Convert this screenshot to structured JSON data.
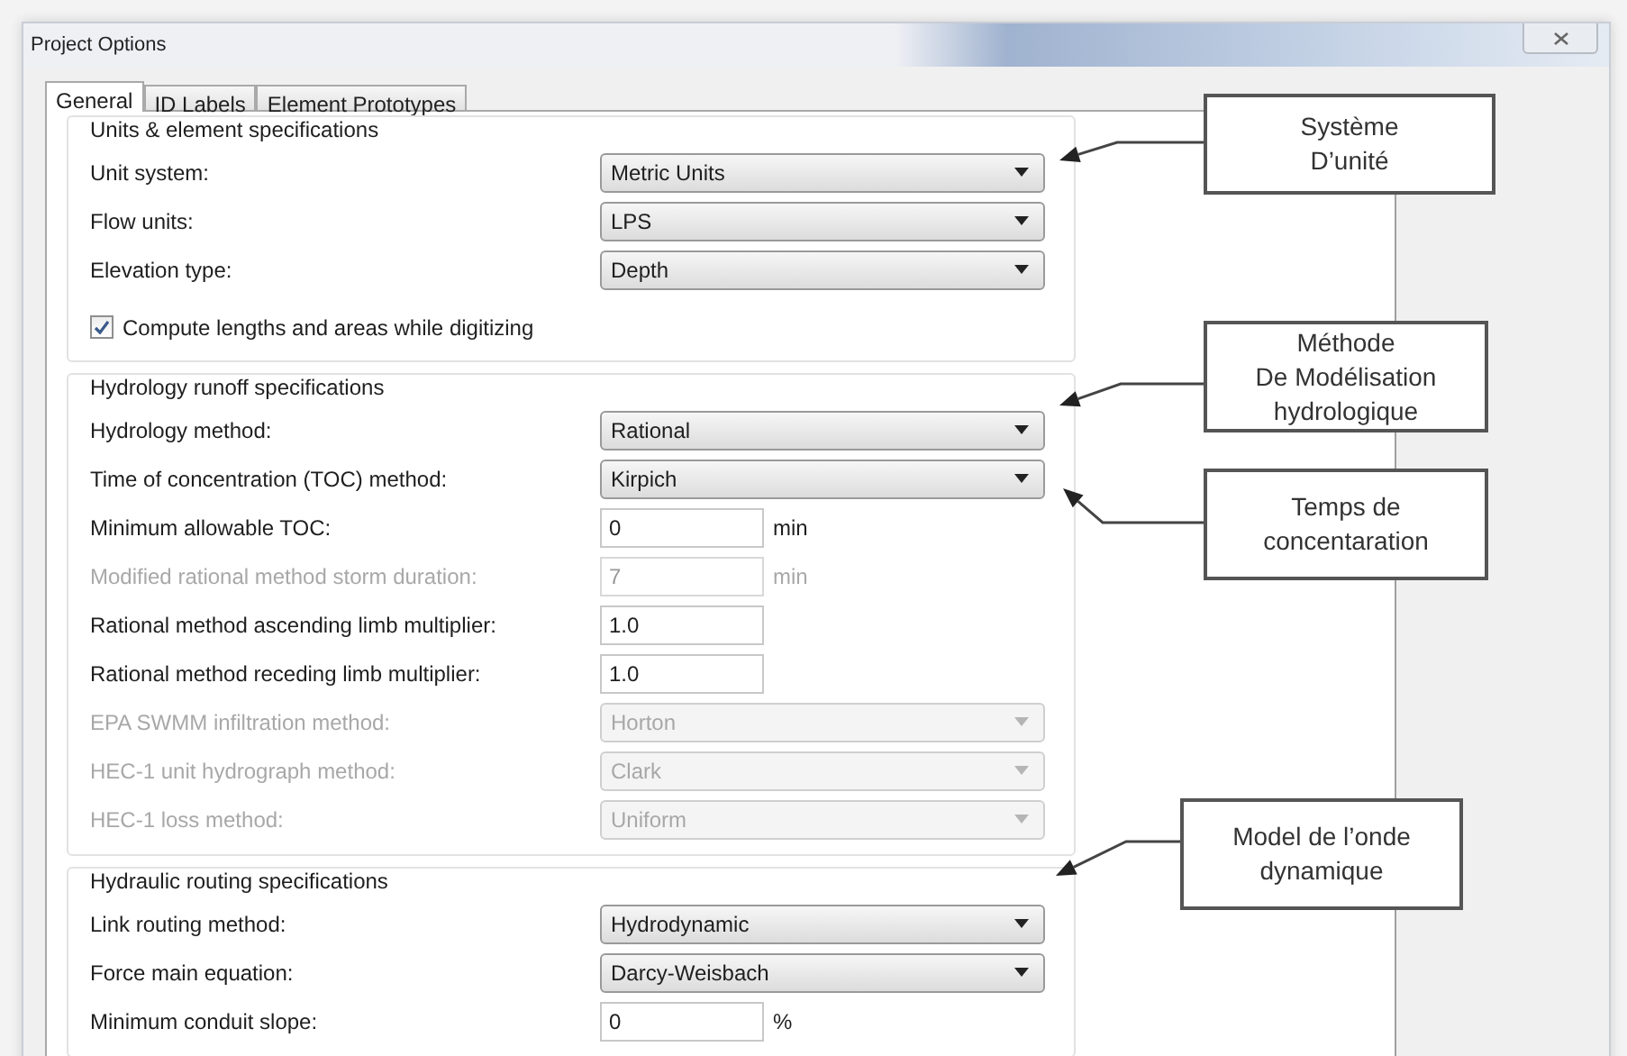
{
  "window": {
    "title": "Project Options"
  },
  "tabs": [
    {
      "label": "General",
      "selected": true
    },
    {
      "label": "ID Labels",
      "selected": false
    },
    {
      "label": "Element Prototypes",
      "selected": false
    }
  ],
  "sections": [
    {
      "title": "Units & element specifications",
      "rows": [
        {
          "kind": "combo",
          "label": "Unit system:",
          "value": "Metric Units",
          "disabled": false
        },
        {
          "kind": "combo",
          "label": "Flow units:",
          "value": "LPS",
          "disabled": false
        },
        {
          "kind": "combo",
          "label": "Elevation type:",
          "value": "Depth",
          "disabled": false
        },
        {
          "kind": "checkbox",
          "label": "Compute lengths and areas while digitizing",
          "checked": true
        }
      ]
    },
    {
      "title": "Hydrology runoff specifications",
      "rows": [
        {
          "kind": "combo",
          "label": "Hydrology method:",
          "value": "Rational",
          "disabled": false
        },
        {
          "kind": "combo",
          "label": "Time of concentration (TOC) method:",
          "value": "Kirpich",
          "disabled": false
        },
        {
          "kind": "number",
          "label": "Minimum allowable TOC:",
          "value": "0",
          "unit": "min",
          "disabled": false
        },
        {
          "kind": "number",
          "label": "Modified rational method storm duration:",
          "value": "7",
          "unit": "min",
          "disabled": true
        },
        {
          "kind": "number",
          "label": "Rational method ascending limb multiplier:",
          "value": "1.0",
          "disabled": false
        },
        {
          "kind": "number",
          "label": "Rational method receding limb multiplier:",
          "value": "1.0",
          "disabled": false
        },
        {
          "kind": "combo",
          "label": "EPA SWMM infiltration method:",
          "value": "Horton",
          "disabled": true
        },
        {
          "kind": "combo",
          "label": "HEC-1 unit hydrograph method:",
          "value": "Clark",
          "disabled": true
        },
        {
          "kind": "combo",
          "label": "HEC-1 loss method:",
          "value": "Uniform",
          "disabled": true
        }
      ]
    },
    {
      "title": "Hydraulic routing specifications",
      "rows": [
        {
          "kind": "combo",
          "label": "Link routing method:",
          "value": "Hydrodynamic",
          "disabled": false
        },
        {
          "kind": "combo",
          "label": "Force main equation:",
          "value": "Darcy-Weisbach",
          "disabled": false
        },
        {
          "kind": "number",
          "label": "Minimum conduit slope:",
          "value": "0",
          "unit": "%",
          "disabled": false
        }
      ]
    }
  ],
  "callouts": [
    {
      "lines": [
        "Système",
        "D’unité"
      ]
    },
    {
      "lines": [
        "Méthode",
        "De Modélisation",
        "hydrologique"
      ]
    },
    {
      "lines": [
        "Temps de",
        "concentaration"
      ]
    },
    {
      "lines": [
        "Model de l’onde",
        "dynamique"
      ]
    }
  ]
}
